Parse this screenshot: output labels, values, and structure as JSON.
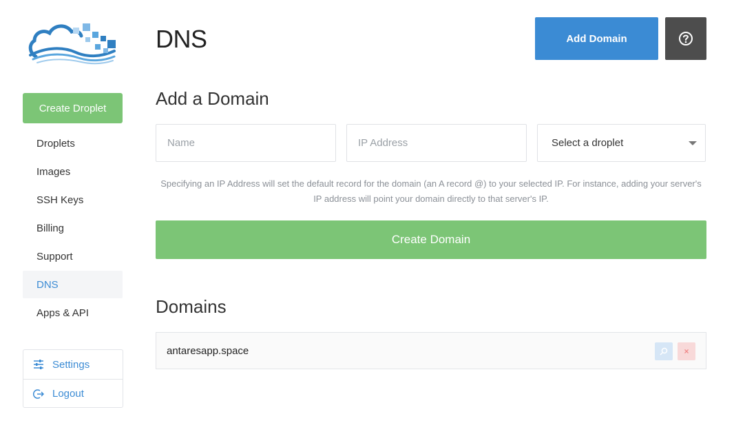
{
  "sidebar": {
    "create_droplet": "Create Droplet",
    "items": [
      {
        "label": "Droplets"
      },
      {
        "label": "Images"
      },
      {
        "label": "SSH Keys"
      },
      {
        "label": "Billing"
      },
      {
        "label": "Support"
      },
      {
        "label": "DNS",
        "active": true
      },
      {
        "label": "Apps & API"
      }
    ],
    "account": {
      "settings": "Settings",
      "logout": "Logout"
    }
  },
  "header": {
    "title": "DNS",
    "add_domain": "Add Domain",
    "help_icon": "question-circle-icon"
  },
  "add_domain_form": {
    "title": "Add a Domain",
    "name_placeholder": "Name",
    "ip_placeholder": "IP Address",
    "droplet_select": "Select a droplet",
    "help_text": "Specifying an IP Address will set the default record for the domain (an A record @) to your selected IP. For instance, adding your server's IP address will point your domain directly to that server's IP.",
    "submit": "Create Domain"
  },
  "domains": {
    "title": "Domains",
    "rows": [
      {
        "name": "antaresapp.space",
        "view_icon": "magnifier-icon",
        "delete_label": "×"
      }
    ]
  },
  "colors": {
    "primary_blue": "#3b8bd4",
    "green": "#7cc576",
    "dark_button": "#4d4d4d"
  }
}
